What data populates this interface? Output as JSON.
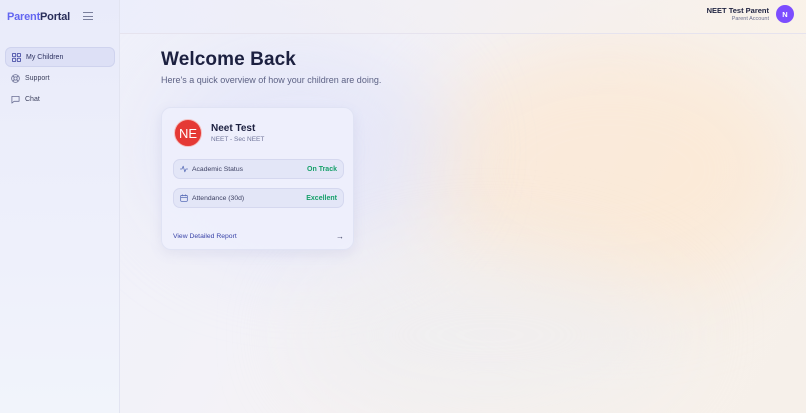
{
  "brand": {
    "part1": "Parent",
    "part2": "Portal"
  },
  "sidebar": {
    "items": [
      {
        "label": "My Children",
        "icon": "grid-icon",
        "active": true
      },
      {
        "label": "Support",
        "icon": "lifebuoy-icon",
        "active": false
      },
      {
        "label": "Chat",
        "icon": "message-icon",
        "active": false
      }
    ]
  },
  "header": {
    "user_name": "NEET Test Parent",
    "user_role": "Parent Account",
    "avatar_initial": "N"
  },
  "main": {
    "title": "Welcome Back",
    "subtitle": "Here's a quick overview of how your children are doing."
  },
  "children": [
    {
      "initials": "NE",
      "name": "Neet Test",
      "class": "NEET - Sec NEET",
      "stats": [
        {
          "label": "Academic Status",
          "value": "On Track",
          "icon": "activity-icon"
        },
        {
          "label": "Attendance (30d)",
          "value": "Excellent",
          "icon": "calendar-icon"
        }
      ],
      "report_link": "View Detailed Report"
    }
  ],
  "colors": {
    "accent": "#6366f1",
    "avatar_top": "#7c4dff",
    "child_avatar": "#e53935",
    "status_good": "#16a06a"
  }
}
